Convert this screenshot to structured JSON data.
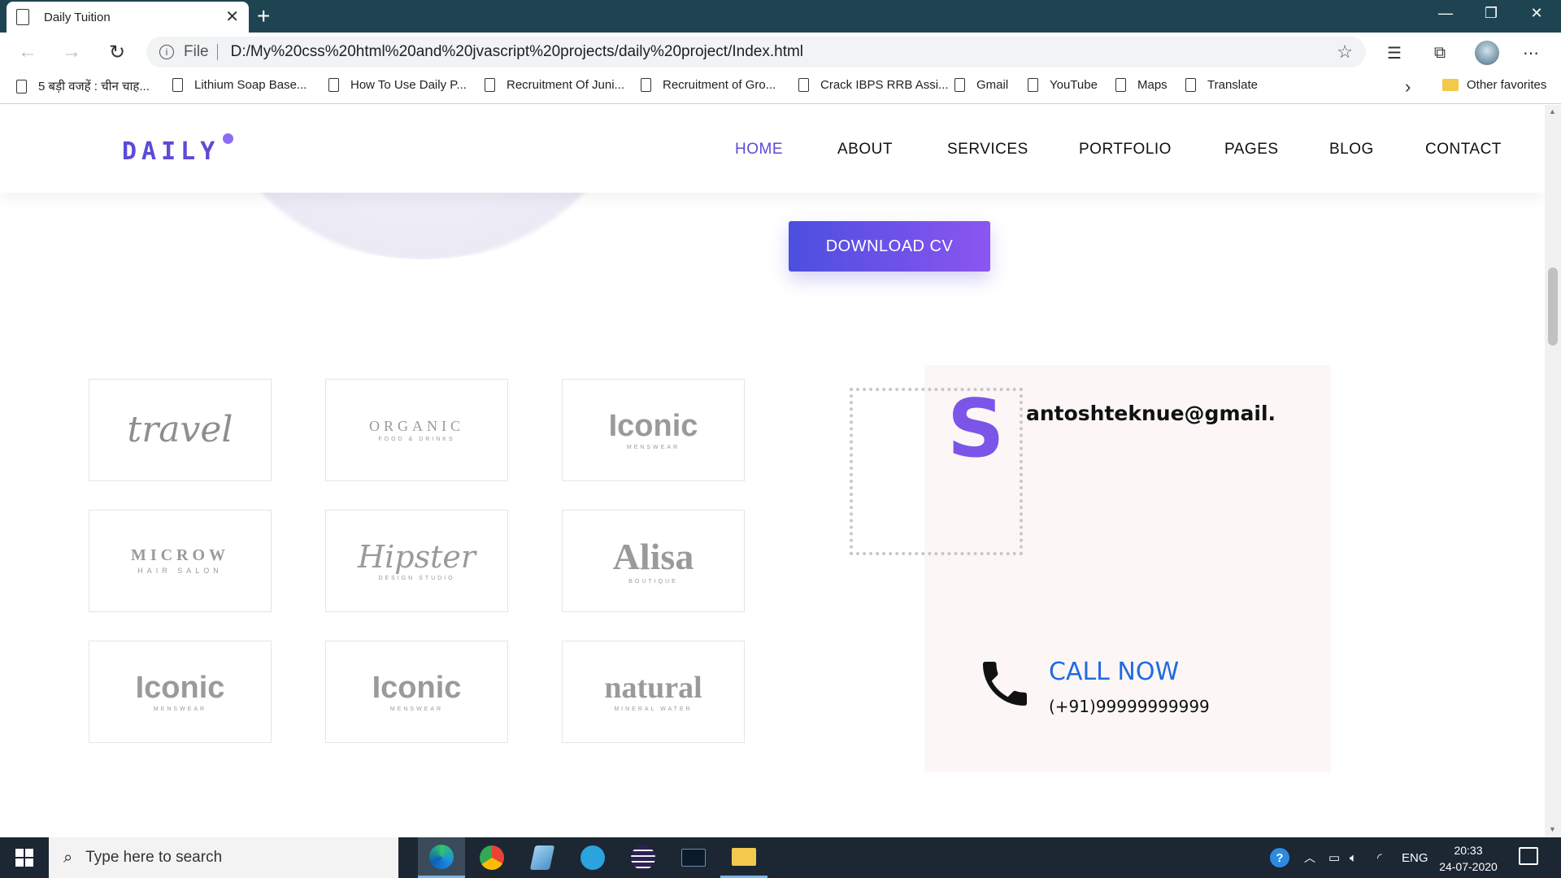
{
  "browser": {
    "tab_title": "Daily Tuition",
    "url_scheme": "File",
    "url": "D:/My%20css%20html%20and%20jvascript%20projects/daily%20project/Index.html",
    "bookmarks": [
      "5 बड़ी वजहें : चीन चाह...",
      "Lithium Soap Base...",
      "How To Use Daily P...",
      "Recruitment Of Juni...",
      "Recruitment of Gro...",
      "Crack IBPS RRB Assi...",
      "Gmail",
      "YouTube",
      "Maps",
      "Translate"
    ],
    "other_favorites": "Other favorites"
  },
  "site": {
    "logo": "DAILY",
    "nav": [
      "HOME",
      "ABOUT",
      "SERVICES",
      "PORTFOLIO",
      "PAGES",
      "BLOG",
      "CONTACT"
    ],
    "active_nav": "HOME",
    "download_cv": "DOWNLOAD CV",
    "brands": [
      {
        "name": "travel",
        "sub": ""
      },
      {
        "name": "ORGANIC",
        "sub": "FOOD & DRINKS"
      },
      {
        "name": "Iconic",
        "sub": "MENSWEAR"
      },
      {
        "name": "MICROW",
        "sub": "HAIR SALON"
      },
      {
        "name": "Hipster",
        "sub": "DESIGN STUDIO"
      },
      {
        "name": "Alisa",
        "sub": "BOUTIQUE"
      },
      {
        "name": "Iconic",
        "sub": "MENSWEAR"
      },
      {
        "name": "Iconic",
        "sub": "MENSWEAR"
      },
      {
        "name": "natural",
        "sub": "MINERAL WATER"
      }
    ],
    "contact": {
      "initial": "S",
      "email": "antoshteknue@gmail.",
      "call_label": "CALL NOW",
      "phone": "(+91)99999999999"
    }
  },
  "taskbar": {
    "search_placeholder": "Type here to search",
    "language": "ENG",
    "time": "20:33",
    "date": "24-07-2020"
  },
  "colors": {
    "accent": "#5b4bd6",
    "button_start": "#4c4fde",
    "button_end": "#8b55f0",
    "call_blue": "#1f6be0",
    "titlebar": "#1f4451"
  }
}
